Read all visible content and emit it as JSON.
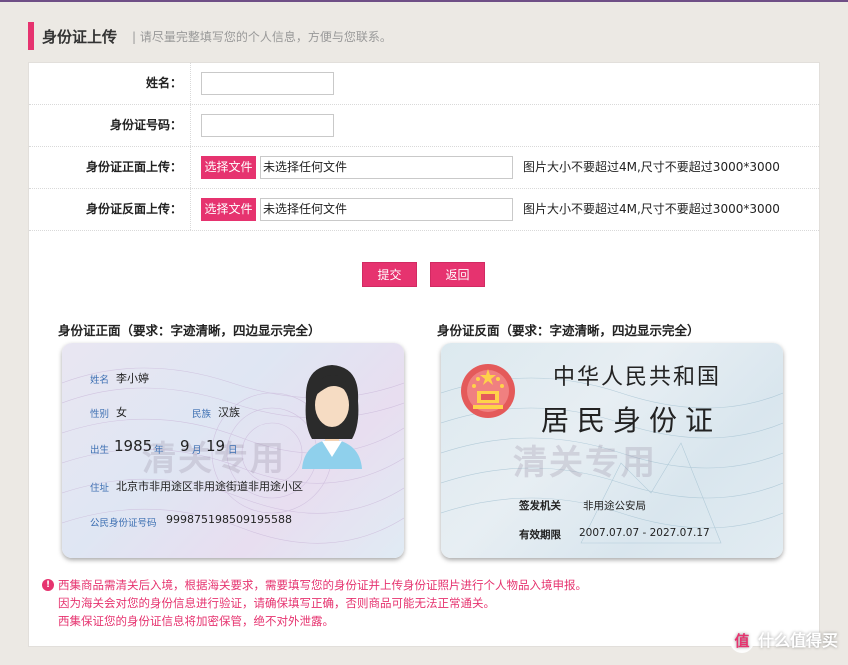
{
  "header": {
    "title": "身份证上传",
    "subtitle": "| 请尽量完整填写您的个人信息，方便与您联系。"
  },
  "form": {
    "name_label": "姓名：",
    "name_value": "",
    "idnum_label": "身份证号码：",
    "idnum_value": "",
    "front_label": "身份证正面上传：",
    "back_label": "身份证反面上传：",
    "choose_file": "选择文件",
    "no_file": "未选择任何文件",
    "file_hint": "图片大小不要超过4M,尺寸不要超过3000*3000"
  },
  "buttons": {
    "submit": "提交",
    "back": "返回"
  },
  "samples": {
    "front_caption": "身份证正面（要求：字迹清晰，四边显示完全）",
    "back_caption": "身份证反面（要求：字迹清晰，四边显示完全）",
    "watermark": "清关专用",
    "front": {
      "name_lbl": "姓名",
      "name_val": "李小婷",
      "gender_lbl": "性别",
      "gender_val": "女",
      "ethnic_lbl": "民族",
      "ethnic_val": "汉族",
      "birth_lbl": "出生",
      "birth_year": "1985",
      "year_unit": "年",
      "birth_month": "9",
      "month_unit": "月",
      "birth_day": "19",
      "day_unit": "日",
      "addr_lbl": "住址",
      "addr_val": "北京市非用途区非用途街道非用途小区",
      "id_lbl": "公民身份证号码",
      "id_val": "999875198509195588"
    },
    "back": {
      "country": "中华人民共和国",
      "card_name": "居民身份证",
      "issuer_lbl": "签发机关",
      "issuer_val": "非用途公安局",
      "valid_lbl": "有效期限",
      "valid_val": "2007.07.07 - 2027.07.17"
    }
  },
  "notice": {
    "icon": "!",
    "line1": "西集商品需清关后入境，根据海关要求，需要填写您的身份证并上传身份证照片进行个人物品入境申报。",
    "line2": "因为海关会对您的身份信息进行验证，请确保填写正确，否则商品可能无法正常通关。",
    "line3": "西集保证您的身份证信息将加密保管，绝不对外泄露。"
  },
  "brand": {
    "mark": "值",
    "text": "什么值得买"
  },
  "colors": {
    "accent": "#e6336f",
    "purple_line": "#6f4f86"
  }
}
